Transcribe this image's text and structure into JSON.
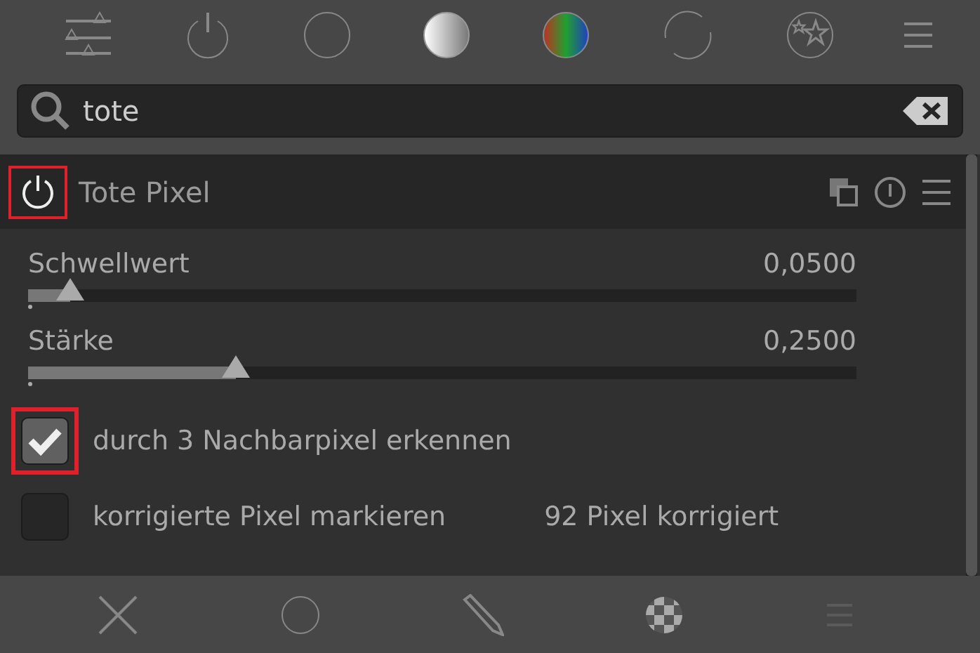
{
  "module_groups": [
    {
      "kind": "sliders",
      "selected": false
    },
    {
      "kind": "power",
      "selected": false
    },
    {
      "kind": "circle",
      "selected": false
    },
    {
      "kind": "gray",
      "selected": false
    },
    {
      "kind": "color",
      "selected": false
    },
    {
      "kind": "cycle",
      "selected": false
    },
    {
      "kind": "stars",
      "selected": false
    }
  ],
  "search": {
    "value": "tote"
  },
  "module": {
    "title": "Tote Pixel",
    "enabled": true,
    "highlighted": true
  },
  "sliders": [
    {
      "label": "Schwellwert",
      "reading": "0,0500",
      "level": 0.05
    },
    {
      "label": "Stärke",
      "reading": "0,2500",
      "level": 0.25
    }
  ],
  "checkboxes": [
    {
      "label": "durch 3 Nachbarpixel erkennen",
      "checked": true,
      "highlighted": true
    },
    {
      "label": "korrigierte Pixel markieren",
      "checked": false,
      "highlighted": false,
      "note": "92 Pixel korrigiert"
    }
  ],
  "mask_modes": [
    {
      "kind": "off"
    },
    {
      "kind": "uniform"
    },
    {
      "kind": "drawn"
    },
    {
      "kind": "parametric"
    }
  ]
}
